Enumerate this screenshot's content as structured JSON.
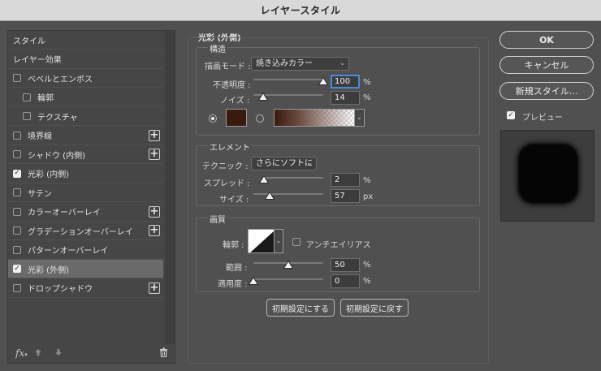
{
  "window": {
    "title": "レイヤースタイル"
  },
  "styles_list": {
    "items": [
      {
        "label": "スタイル",
        "checkbox": false,
        "checked": false,
        "plus": false,
        "indent": 0,
        "selected": false
      },
      {
        "label": "レイヤー効果",
        "checkbox": false,
        "checked": false,
        "plus": false,
        "indent": 0,
        "selected": false
      },
      {
        "label": "ベベルとエンボス",
        "checkbox": true,
        "checked": false,
        "plus": false,
        "indent": 0,
        "selected": false
      },
      {
        "label": "輪郭",
        "checkbox": true,
        "checked": false,
        "plus": false,
        "indent": 1,
        "selected": false
      },
      {
        "label": "テクスチャ",
        "checkbox": true,
        "checked": false,
        "plus": false,
        "indent": 1,
        "selected": false
      },
      {
        "label": "境界線",
        "checkbox": true,
        "checked": false,
        "plus": true,
        "indent": 0,
        "selected": false
      },
      {
        "label": "シャドウ (内側)",
        "checkbox": true,
        "checked": false,
        "plus": true,
        "indent": 0,
        "selected": false
      },
      {
        "label": "光彩 (内側)",
        "checkbox": true,
        "checked": true,
        "plus": false,
        "indent": 0,
        "selected": false
      },
      {
        "label": "サテン",
        "checkbox": true,
        "checked": false,
        "plus": false,
        "indent": 0,
        "selected": false
      },
      {
        "label": "カラーオーバーレイ",
        "checkbox": true,
        "checked": false,
        "plus": true,
        "indent": 0,
        "selected": false
      },
      {
        "label": "グラデーションオーバーレイ",
        "checkbox": true,
        "checked": false,
        "plus": true,
        "indent": 0,
        "selected": false
      },
      {
        "label": "パターンオーバーレイ",
        "checkbox": true,
        "checked": false,
        "plus": false,
        "indent": 0,
        "selected": false
      },
      {
        "label": "光彩 (外側)",
        "checkbox": true,
        "checked": true,
        "plus": false,
        "indent": 0,
        "selected": true
      },
      {
        "label": "ドロップシャドウ",
        "checkbox": true,
        "checked": false,
        "plus": true,
        "indent": 0,
        "selected": false
      }
    ],
    "footer": {
      "fx_label": "fx"
    }
  },
  "panel": {
    "title": "光彩 (外側)",
    "structure": {
      "title": "構造",
      "blend_mode_label": "描画モード :",
      "blend_mode_value": "焼き込みカラー",
      "opacity_label": "不透明度 :",
      "opacity_value": "100",
      "opacity_level": 1.0,
      "noise_label": "ノイズ :",
      "noise_value": "14",
      "noise_level": 0.14,
      "percent": "%",
      "color": "#3a1a0e"
    },
    "elements": {
      "title": "エレメント",
      "technique_label": "テクニック :",
      "technique_value": "さらにソフトに",
      "spread_label": "スプレッド :",
      "spread_value": "2",
      "spread_level": 0.02,
      "size_label": "サイズ :",
      "size_value": "57",
      "size_level": 0.23,
      "percent": "%",
      "px": "px"
    },
    "quality": {
      "title": "画質",
      "contour_label": "輪郭 :",
      "antialias_label": "アンチエイリアス",
      "antialias_checked": false,
      "range_label": "範囲 :",
      "range_value": "50",
      "range_level": 0.5,
      "jitter_label": "適用度 :",
      "jitter_value": "0",
      "jitter_level": 0.0,
      "percent": "%"
    },
    "default_buttons": {
      "make_default": "初期設定にする",
      "reset_default": "初期設定に戻す"
    }
  },
  "right": {
    "ok": "OK",
    "cancel": "キャンセル",
    "new_style": "新規スタイル...",
    "preview_label": "プレビュー",
    "preview_checked": true
  }
}
